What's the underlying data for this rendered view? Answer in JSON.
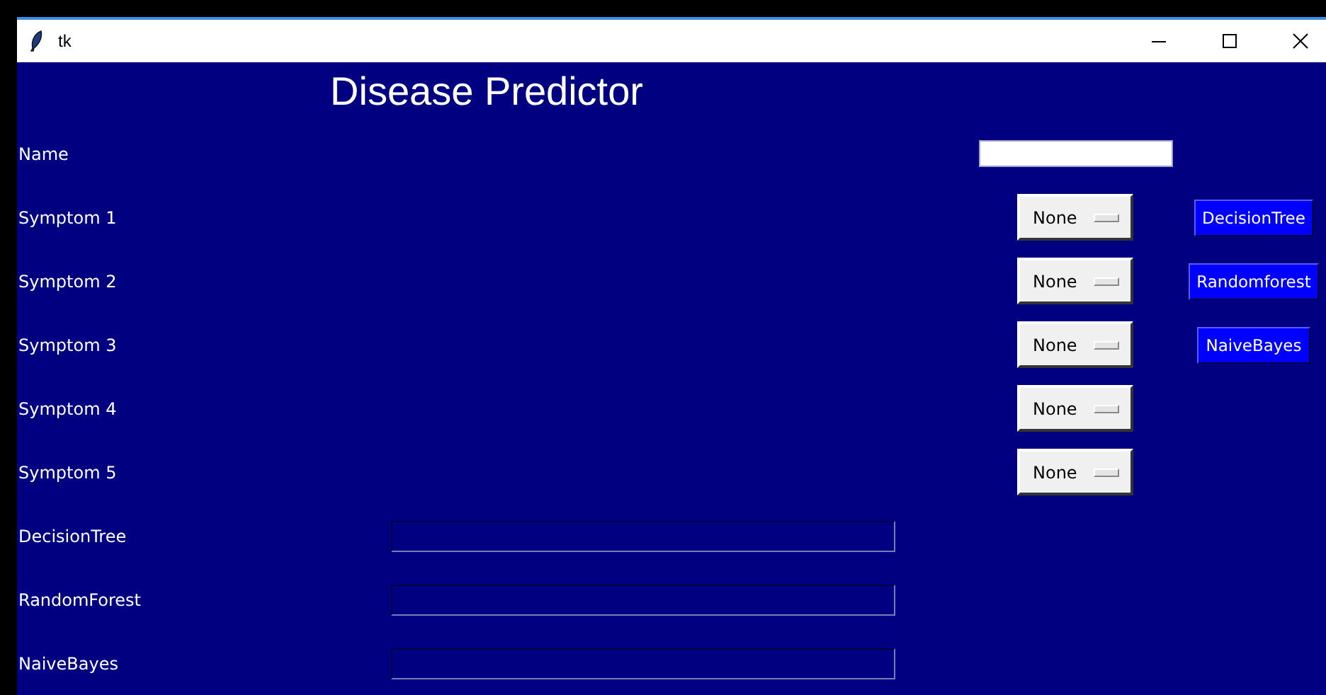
{
  "window": {
    "title": "tk"
  },
  "heading": "Disease Predictor",
  "name_field": {
    "label": "Name"
  },
  "symptoms": [
    {
      "label": "Symptom 1",
      "value": "None"
    },
    {
      "label": "Symptom 2",
      "value": "None"
    },
    {
      "label": "Symptom 3",
      "value": "None"
    },
    {
      "label": "Symptom 4",
      "value": "None"
    },
    {
      "label": "Symptom 5",
      "value": "None"
    }
  ],
  "buttons": [
    "DecisionTree",
    "Randomforest",
    "NaiveBayes"
  ],
  "results": [
    {
      "label": "DecisionTree"
    },
    {
      "label": "RandomForest"
    },
    {
      "label": "NaiveBayes"
    }
  ]
}
